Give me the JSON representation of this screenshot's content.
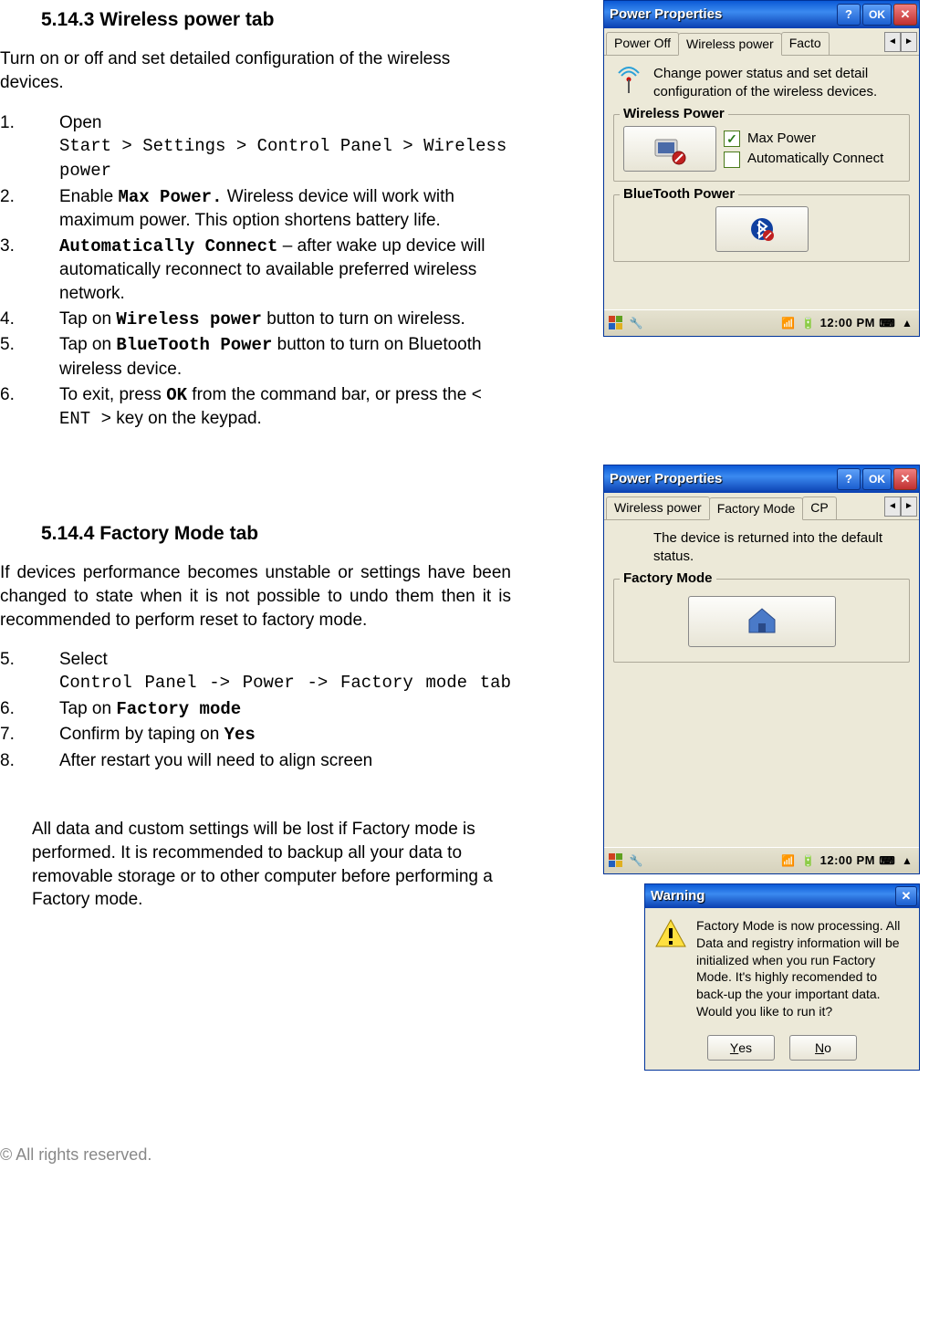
{
  "section1": {
    "heading": "5.14.3 Wireless power tab",
    "intro": "Turn on or off and set detailed configuration of the wireless devices.",
    "steps": [
      {
        "n": "1.",
        "pre": "Open",
        "path": "Start > Settings > Control Panel > Wireless power"
      },
      {
        "n": "2.",
        "a": "Enable ",
        "b": "Max Power.",
        "c": "  Wireless device will work with maximum power. This option shortens battery life."
      },
      {
        "n": "3.",
        "b": "Automatically Connect",
        "c": " – after wake up device will automatically reconnect to available preferred wireless network."
      },
      {
        "n": "4.",
        "a": "Tap on ",
        "b": "Wireless power",
        "c": " button to turn on wireless."
      },
      {
        "n": "5.",
        "a": "Tap on ",
        "b": "BlueTooth Power",
        "c": " button to turn on Bluetooth wireless device."
      },
      {
        "n": "6.",
        "a": "To exit, press ",
        "b": "OK",
        "c": " from the command bar, or press the ",
        "d": "< ENT >",
        "e": " key on the keypad."
      }
    ]
  },
  "section2": {
    "heading": "5.14.4 Factory Mode tab",
    "intro": "If devices performance becomes unstable or settings have been changed to state when it is not possible to undo them then it is recommended to perform reset to factory mode.",
    "steps": [
      {
        "n": "5.",
        "pre": "Select",
        "path": "Control Panel -> Power -> Factory mode tab"
      },
      {
        "n": "6.",
        "a": "Tap on ",
        "b": "Factory mode"
      },
      {
        "n": "7.",
        "a": "Confirm by taping on  ",
        "b": "Yes"
      },
      {
        "n": "8.",
        "a": "After restart you will need to align screen"
      }
    ],
    "note": "All data and custom settings will be lost if Factory mode is performed. It is recommended to backup all your data to removable storage or to other computer before performing a Factory mode."
  },
  "screenshot1": {
    "title": "Power Properties",
    "tabs": [
      "Power Off",
      "Wireless power",
      "Facto"
    ],
    "active_tab": 1,
    "desc": "Change power status and set detail configuration of the wireless devices.",
    "group1": {
      "legend": "Wireless Power",
      "cb1": {
        "label": "Max Power",
        "checked": true
      },
      "cb2": {
        "label": "Automatically Connect",
        "checked": false
      }
    },
    "group2": {
      "legend": "BlueTooth Power"
    },
    "clock": "12:00 PM"
  },
  "screenshot2": {
    "title": "Power Properties",
    "tabs": [
      "Wireless power",
      "Factory Mode",
      "CP"
    ],
    "active_tab": 1,
    "desc": "The device is returned into the default status.",
    "group1": {
      "legend": "Factory Mode"
    },
    "clock": "12:00 PM"
  },
  "warning": {
    "title": "Warning",
    "text": "Factory Mode is now processing. All Data and registry information will be initialized when you run Factory Mode. It's highly recomended to back-up the your important data. Would you like to run it?",
    "yes_u": "Y",
    "yes_rest": "es",
    "no_u": "N",
    "no_rest": "o"
  },
  "footer": "© All rights reserved."
}
